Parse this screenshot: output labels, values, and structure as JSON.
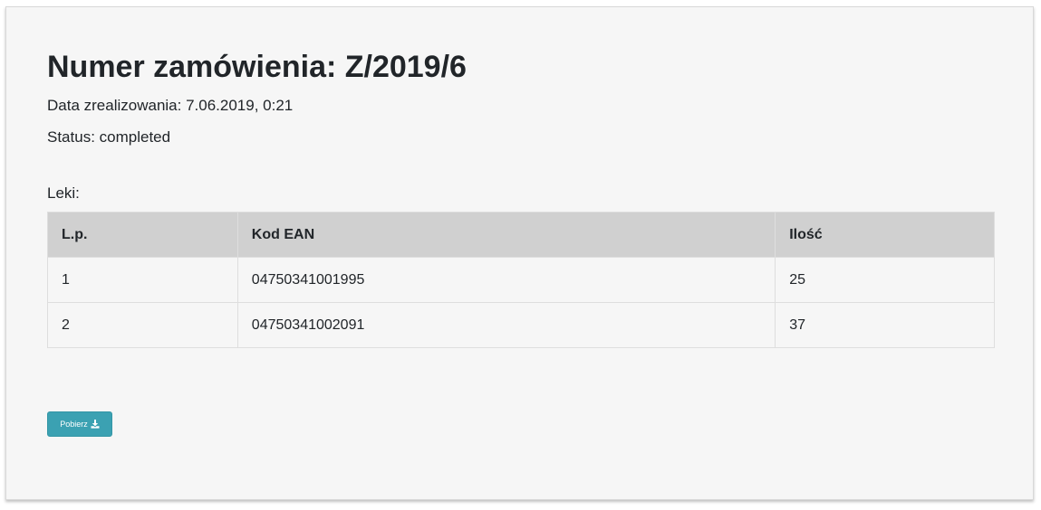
{
  "order": {
    "title": "Numer zamówienia: Z/2019/6",
    "date_text": "Data zrealizowania: 7.06.2019, 0:21",
    "status_text": "Status: completed",
    "items_label": "Leki:"
  },
  "table": {
    "headers": [
      "L.p.",
      "Kod EAN",
      "Ilość"
    ],
    "rows": [
      [
        "1",
        "04750341001995",
        "25"
      ],
      [
        "2",
        "04750341002091",
        "37"
      ]
    ]
  },
  "download_button": {
    "label": "Pobierz",
    "icon": "download-icon",
    "color": "#3ba1b2"
  }
}
